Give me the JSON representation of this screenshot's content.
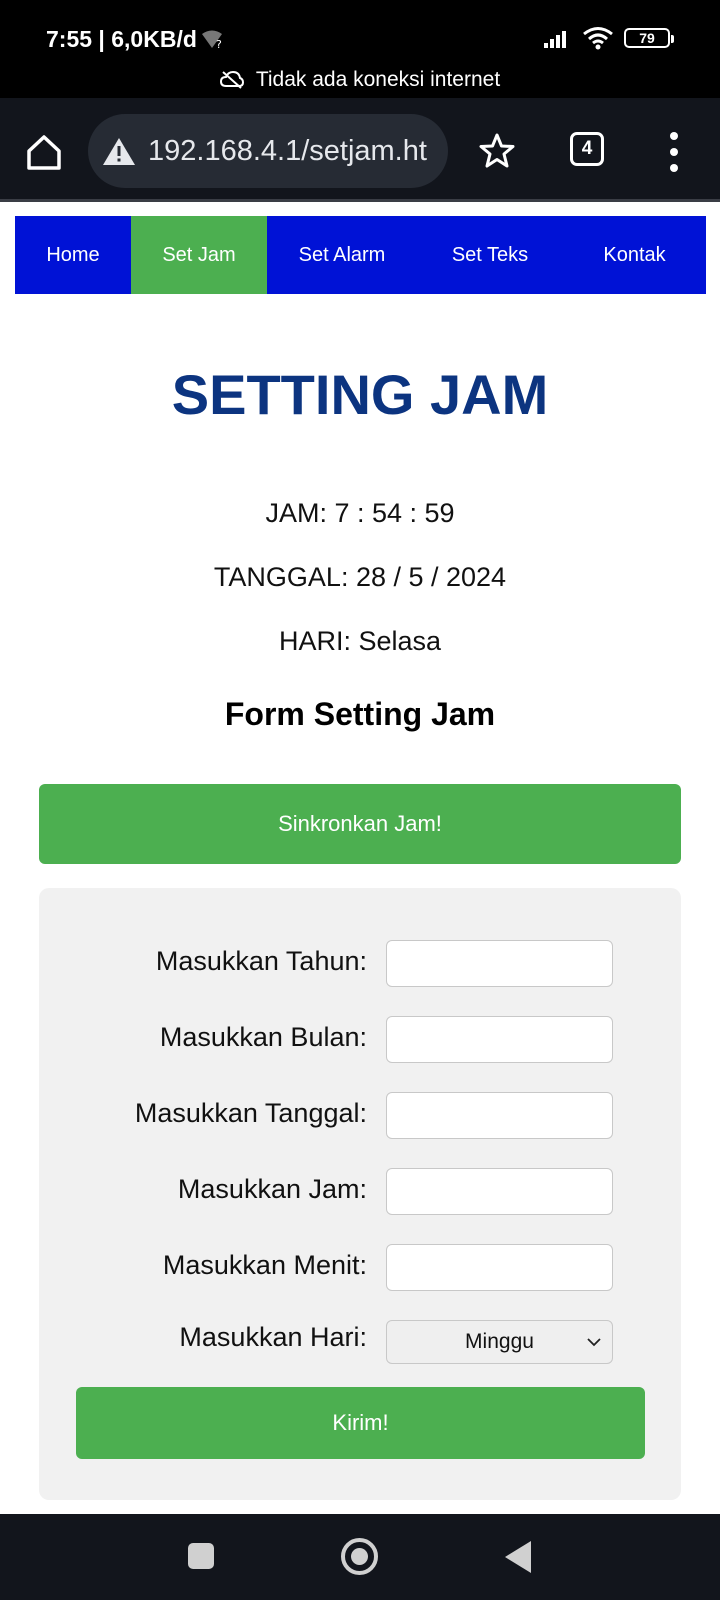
{
  "status_bar": {
    "time": "7:55 | 6,0KB/d",
    "battery": "79",
    "offline_text": "Tidak ada koneksi internet"
  },
  "browser": {
    "url": "192.168.4.1/setjam.ht",
    "tab_count": "4"
  },
  "nav": {
    "items": [
      {
        "label": "Home",
        "active": false
      },
      {
        "label": "Set Jam",
        "active": true
      },
      {
        "label": "Set Alarm",
        "active": false
      },
      {
        "label": "Set Teks",
        "active": false
      },
      {
        "label": "Kontak",
        "active": false
      }
    ]
  },
  "page": {
    "title": "SETTING JAM",
    "jam": "JAM: 7 : 54 : 59",
    "tanggal": "TANGGAL: 28 / 5 / 2024",
    "hari": "HARI: Selasa",
    "form_title": "Form Setting Jam",
    "sync_button": "Sinkronkan Jam!"
  },
  "form": {
    "fields": [
      {
        "label": "Masukkan Tahun:",
        "value": ""
      },
      {
        "label": "Masukkan Bulan:",
        "value": ""
      },
      {
        "label": "Masukkan Tanggal:",
        "value": ""
      },
      {
        "label": "Masukkan Jam:",
        "value": ""
      },
      {
        "label": "Masukkan Menit:",
        "value": ""
      }
    ],
    "day_label": "Masukkan Hari:",
    "day_selected": "Minggu",
    "submit_button": "Kirim!"
  },
  "colors": {
    "nav_bg": "#0012d6",
    "accent_green": "#4caf50",
    "title_blue": "#0c3480"
  }
}
